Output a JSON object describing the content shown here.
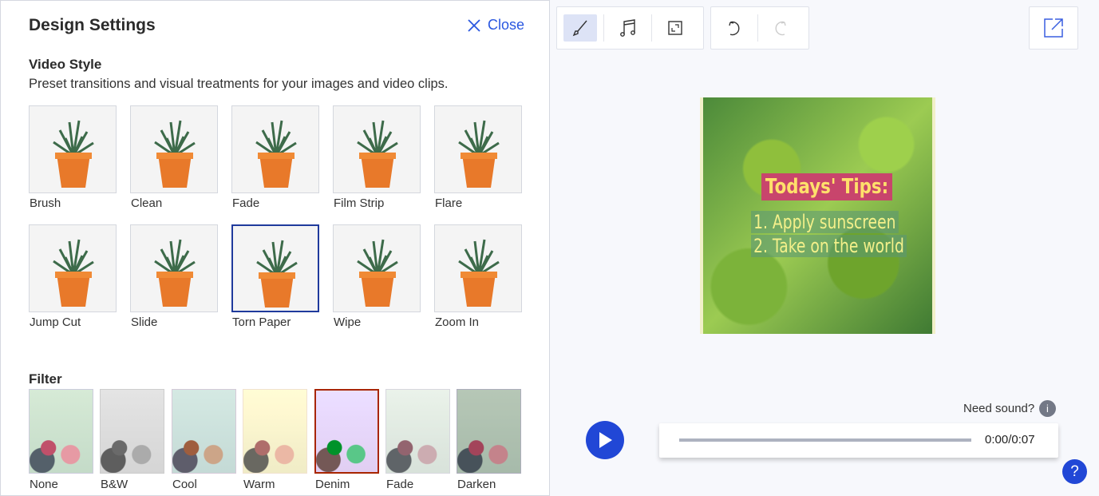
{
  "panel": {
    "title": "Design Settings",
    "close_label": "Close"
  },
  "video_style": {
    "heading": "Video Style",
    "description": "Preset transitions and visual treatments for your images and video clips.",
    "styles": [
      {
        "label": "Brush"
      },
      {
        "label": "Clean"
      },
      {
        "label": "Fade"
      },
      {
        "label": "Film Strip"
      },
      {
        "label": "Flare"
      },
      {
        "label": "Jump Cut"
      },
      {
        "label": "Slide"
      },
      {
        "label": "Torn Paper",
        "selected": true
      },
      {
        "label": "Wipe"
      },
      {
        "label": "Zoom In"
      }
    ]
  },
  "filter": {
    "heading": "Filter",
    "filters": [
      {
        "label": "None"
      },
      {
        "label": "B&W"
      },
      {
        "label": "Cool"
      },
      {
        "label": "Warm"
      },
      {
        "label": "Denim",
        "selected": true
      },
      {
        "label": "Fade"
      },
      {
        "label": "Darken"
      }
    ]
  },
  "preview": {
    "title": "Todays' Tips:",
    "line1": "1. Apply sunscreen",
    "line2": "2. Take on the world"
  },
  "player": {
    "time": "0:00/0:07",
    "progress": 0,
    "need_sound": "Need sound?",
    "info": "i",
    "help": "?"
  },
  "colors": {
    "accent": "#2147d6",
    "selected_border": "#1f3a9c"
  }
}
